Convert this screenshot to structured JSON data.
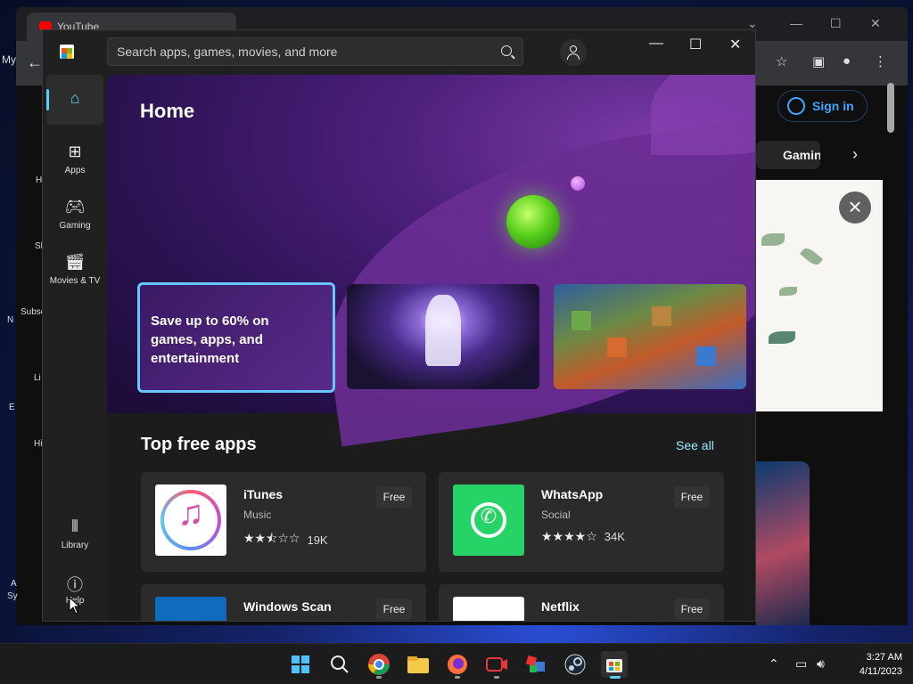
{
  "browser": {
    "tab_title": "YouTube",
    "sign_in_label": "Sign in",
    "chip_label": "Gaming",
    "sidebar_labels": [
      "My",
      "H",
      "Sh",
      "Subsc",
      "N",
      "Li",
      "E",
      "Hi",
      "A",
      "Sy"
    ]
  },
  "store": {
    "search_placeholder": "Search apps, games, movies, and more",
    "nav": {
      "home": "Home",
      "apps": "Apps",
      "gaming": "Gaming",
      "movies": "Movies & TV",
      "library": "Library",
      "help": "Help"
    },
    "hero_title": "Home",
    "promo_text": "Save up to 60% on games, apps, and entertainment",
    "section_title": "Top free apps",
    "see_all": "See all",
    "apps": [
      {
        "name": "iTunes",
        "category": "Music",
        "rating": 2.5,
        "stars": "★★⯪☆☆",
        "count": "19K",
        "price": "Free"
      },
      {
        "name": "WhatsApp",
        "category": "Social",
        "rating": 4,
        "stars": "★★★★☆",
        "count": "34K",
        "price": "Free"
      },
      {
        "name": "Windows Scan",
        "category": "",
        "price": "Free"
      },
      {
        "name": "Netflix",
        "category": "",
        "price": "Free"
      }
    ]
  },
  "taskbar": {
    "time": "3:27 AM",
    "date": "4/11/2023"
  },
  "colors": {
    "accent": "#60cdff",
    "see_all": "#99ebff",
    "whatsapp": "#25d366",
    "youtube_link": "#3ea6ff"
  },
  "icons": [
    "home-icon",
    "apps-icon",
    "gaming-icon",
    "movies-icon",
    "library-icon",
    "help-icon",
    "search-icon",
    "account-icon",
    "windows-start-icon",
    "chrome-icon",
    "file-explorer-icon",
    "firefox-icon",
    "steam-icon",
    "store-icon"
  ]
}
